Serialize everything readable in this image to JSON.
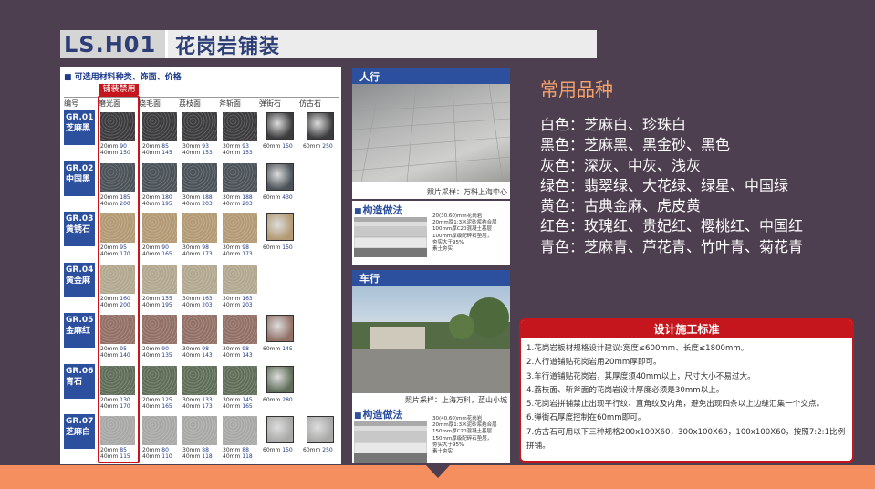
{
  "title": {
    "code": "LS.H01",
    "name": "花岗岩铺装"
  },
  "table": {
    "heading": "可选用材料种类、饰面、价格",
    "banner": "铺装禁用",
    "columns": [
      "编号",
      "磨光面",
      "烧毛面",
      "荔枝面",
      "斧斩面",
      "弹街石",
      "仿古石"
    ],
    "rows": [
      {
        "code": "GR.01",
        "name": "芝麻黑",
        "color": "#3c3c3e",
        "cells": [
          [
            "20mm",
            "90",
            "40mm",
            "150"
          ],
          [
            "20mm",
            "85",
            "40mm",
            "145"
          ],
          [
            "30mm",
            "93",
            "40mm",
            "153"
          ],
          [
            "30mm",
            "93",
            "40mm",
            "153"
          ],
          [
            "60mm",
            "150"
          ],
          [
            "60mm",
            "250"
          ]
        ]
      },
      {
        "code": "GR.02",
        "name": "中国黑",
        "color": "#4b5258",
        "cells": [
          [
            "20mm",
            "185",
            "40mm",
            "200"
          ],
          [
            "20mm",
            "180",
            "40mm",
            "195"
          ],
          [
            "30mm",
            "188",
            "40mm",
            "203"
          ],
          [
            "30mm",
            "188",
            "40mm",
            "203"
          ],
          [
            "60mm",
            "430"
          ],
          []
        ]
      },
      {
        "code": "GR.03",
        "name": "黄锈石",
        "color": "#b39a74",
        "cells": [
          [
            "20mm",
            "95",
            "40mm",
            "170"
          ],
          [
            "20mm",
            "90",
            "40mm",
            "165"
          ],
          [
            "30mm",
            "98",
            "40mm",
            "173"
          ],
          [
            "30mm",
            "98",
            "40mm",
            "173"
          ],
          [
            "60mm",
            "150"
          ],
          []
        ]
      },
      {
        "code": "GR.04",
        "name": "黄金麻",
        "color": "#b2a890",
        "cells": [
          [
            "20mm",
            "160",
            "40mm",
            "200"
          ],
          [
            "20mm",
            "155",
            "40mm",
            "195"
          ],
          [
            "30mm",
            "163",
            "40mm",
            "203"
          ],
          [
            "30mm",
            "163",
            "40mm",
            "203"
          ],
          [],
          []
        ]
      },
      {
        "code": "GR.05",
        "name": "金麻红",
        "color": "#927066",
        "cells": [
          [
            "20mm",
            "95",
            "40mm",
            "140"
          ],
          [
            "20mm",
            "90",
            "40mm",
            "135"
          ],
          [
            "30mm",
            "98",
            "40mm",
            "143"
          ],
          [
            "30mm",
            "98",
            "40mm",
            "143"
          ],
          [
            "60mm",
            "145"
          ],
          []
        ]
      },
      {
        "code": "GR.06",
        "name": "青石",
        "color": "#5f6e58",
        "cells": [
          [
            "20mm",
            "130",
            "40mm",
            "170"
          ],
          [
            "20mm",
            "125",
            "40mm",
            "165"
          ],
          [
            "30mm",
            "133",
            "40mm",
            "173"
          ],
          [
            "30mm",
            "145",
            "40mm",
            "165"
          ],
          [
            "60mm",
            "280"
          ],
          []
        ]
      },
      {
        "code": "GR.07",
        "name": "芝麻白",
        "color": "#a8a8a6",
        "cells": [
          [
            "20mm",
            "85",
            "40mm",
            "115"
          ],
          [
            "20mm",
            "80",
            "40mm",
            "110"
          ],
          [
            "30mm",
            "88",
            "40mm",
            "118"
          ],
          [
            "30mm",
            "88",
            "40mm",
            "118"
          ],
          [
            "60mm",
            "150"
          ],
          [
            "60mm",
            "250"
          ]
        ]
      }
    ]
  },
  "pedestrian": {
    "label": "人行",
    "caption": "照片采样：万科上海中心",
    "construct_title": "构造做法",
    "layers": [
      "20(30.60)mm花岗岩",
      "20mm厚1:3水泥砂浆结合层",
      "100mm厚C20混凝土基层",
      "100mm厚级配碎石垫层，",
      "夯实大于95%",
      "素土夯实"
    ]
  },
  "vehicle": {
    "label": "车行",
    "caption": "照片采样：上海万科，蓝山小城",
    "construct_title": "构造做法",
    "layers": [
      "30(40.60)mm花岗岩",
      "20mm厚1:3水泥砂浆结合层",
      "150mm厚C20混凝土基层",
      "150mm厚级配碎石垫层，",
      "夯实大于95%",
      "素土夯实"
    ]
  },
  "common": {
    "title": "常用品种",
    "items": [
      "白色：芝麻白、珍珠白",
      "黑色：芝麻黑、黑金砂、黑色",
      "灰色：深灰、中灰、浅灰",
      "绿色：翡翠绿、大花绿、绿星、中国绿",
      "黄色：古典金麻、虎皮黄",
      "红色：玫瑰红、贵妃红、樱桃红、中国红",
      "青色：芝麻青、芦花青、竹叶青、菊花青"
    ]
  },
  "standard": {
    "title": "设计施工标准",
    "items": [
      "1.花岗岩板材规格设计建议:宽度≤600mm、长度≤1800mm。",
      "2.人行道铺贴花岗岩用20mm厚即可。",
      "3.车行道铺贴花岗岩，其厚度须40mm以上，尺寸大小不易过大。",
      "4.荔枝面、斩斧面的花岗岩设计厚度必须是30mm以上。",
      "5.花岗岩拼铺禁止出现平行纹、直角纹及内角，避免出现四条以上边缝汇集一个交点。",
      "6.弹街石厚度控制在60mm即可。",
      "7.仿古石可用以下三种规格200x100X60，300x100X60，100x100X60，按照7:2:1比例拼铺。"
    ]
  }
}
